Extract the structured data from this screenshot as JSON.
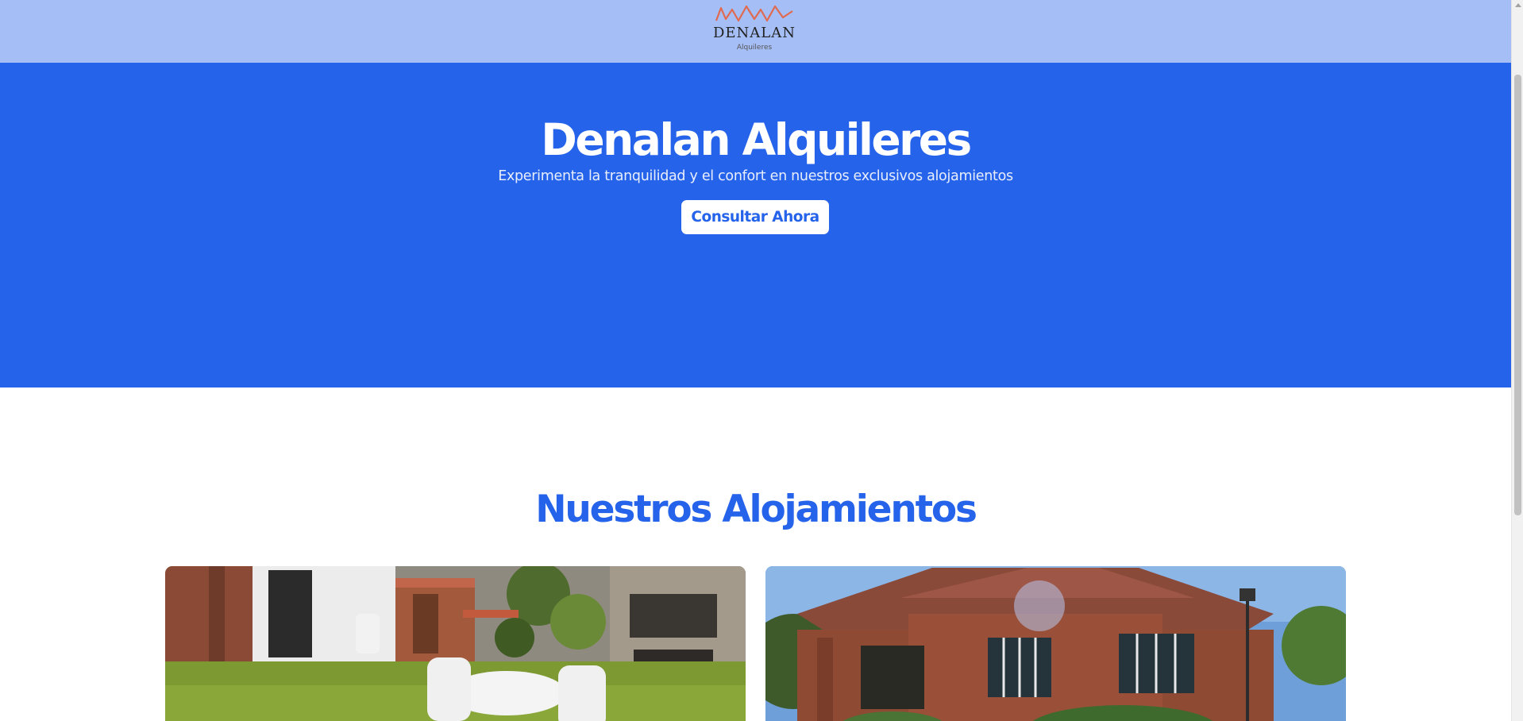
{
  "header": {
    "logo_name": "DENALAN",
    "logo_sub": "Alquileres",
    "logo_accent": "#e06a4f"
  },
  "hero": {
    "title": "Denalan Alquileres",
    "subtitle": "Experimenta la tranquilidad y el confort en nuestros exclusivos alojamientos",
    "cta_label": "Consultar Ahora",
    "background": "#2563eb"
  },
  "section": {
    "title": "Nuestros Alojamientos"
  },
  "cards": [
    {
      "image": "garden-patio-photo"
    },
    {
      "image": "brick-house-photo"
    }
  ],
  "theme": {
    "header_bg": "#a5bef6",
    "accent": "#2563eb"
  }
}
